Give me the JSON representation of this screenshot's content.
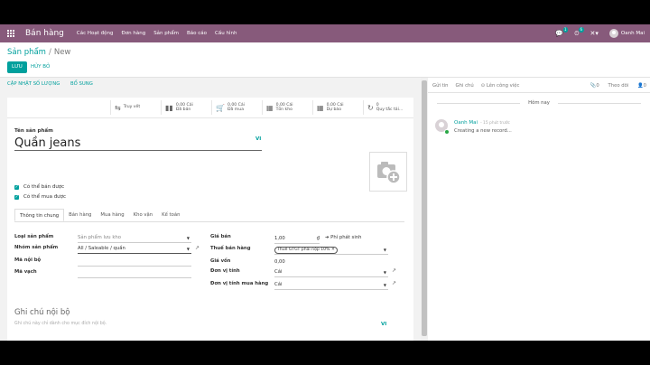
{
  "navbar": {
    "brand": "Bán hàng",
    "menu": [
      "Các Hoạt động",
      "Đơn hàng",
      "Sản phẩm",
      "Báo cáo",
      "Cấu hình"
    ],
    "messages_count": "1",
    "activities_count": "6",
    "user_name": "Oanh Mai"
  },
  "breadcrumb": {
    "parent": "Sản phẩm",
    "current": "New"
  },
  "buttons": {
    "save": "LƯU",
    "discard": "HỦY BỎ"
  },
  "statusbar": {
    "update_qty": "CẬP NHẬT SỐ LƯỢNG",
    "replenish": "BỔ SUNG"
  },
  "smart_buttons": [
    {
      "icon": "⇆",
      "line1": "Truy vết",
      "line2": ""
    },
    {
      "icon": "▮▮",
      "line1": "0,00 Cái",
      "line2": "Đã bán"
    },
    {
      "icon": "🛒",
      "line1": "0,00 Cái",
      "line2": "Đã mua"
    },
    {
      "icon": "▦",
      "line1": "0,00 Cái",
      "line2": "Tồn kho"
    },
    {
      "icon": "▦",
      "line1": "0,00 Cái",
      "line2": "Dự báo"
    },
    {
      "icon": "↻",
      "line1": "0",
      "line2": "Quy tắc tái..."
    }
  ],
  "form": {
    "name_label": "Tên sản phẩm",
    "name_value": "Quần jeans",
    "lang": "VI",
    "can_be_sold": "Có thể bán được",
    "can_be_purchased": "Có thể mua được",
    "tabs": [
      "Thông tin chung",
      "Bán hàng",
      "Mua hàng",
      "Kho vận",
      "Kế toán"
    ],
    "left_fields": [
      {
        "label": "Loại sản phẩm",
        "value": "Sản phẩm lưu kho"
      },
      {
        "label": "Nhóm sản phẩm",
        "value": "All / Saleable / quần"
      },
      {
        "label": "Mã nội bộ",
        "value": ""
      },
      {
        "label": "Mã vạch",
        "value": ""
      }
    ],
    "right_fields": {
      "price_label": "Giá bán",
      "price_value": "1,00",
      "currency": "₫",
      "extra_price": "➜ Phí phát sinh",
      "tax_label": "Thuế bán hàng",
      "tax_value": "Thuế GTGT phải nộp 10%",
      "cost_label": "Giá vốn",
      "cost_value": "0,00",
      "uom_label": "Đơn vị tính",
      "uom_value": "Cái",
      "purchase_uom_label": "Đơn vị tính mua hàng",
      "purchase_uom_value": "Cái"
    },
    "notes_title": "Ghi chú nội bộ",
    "notes_placeholder": "Ghi chú này chỉ dành cho mục đích nội bộ.",
    "notes_lang": "VI"
  },
  "chatter": {
    "send_message": "Gửi tin",
    "log_note": "Ghi chú",
    "schedule_activity": "⊙ Lên công việc",
    "attachments": "📎0",
    "follow": "Theo dõi",
    "followers": "👤0",
    "date_separator": "Hôm nay",
    "message": {
      "author": "Oanh Mai",
      "time": "- 15 phút trước",
      "body": "Creating a new record..."
    }
  }
}
